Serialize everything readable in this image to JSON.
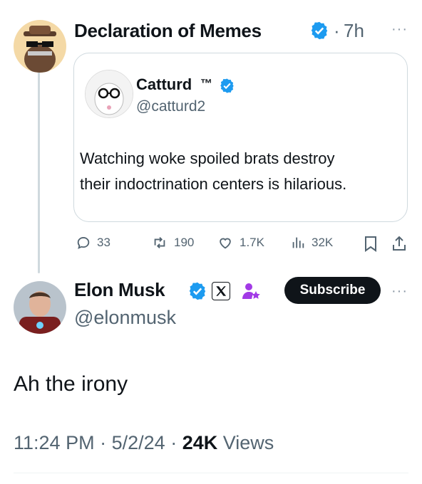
{
  "parent_tweet": {
    "author": "Declaration of Memes",
    "time_separator": "·",
    "time": "7h",
    "more": "···",
    "quoted": {
      "author": "Catturd",
      "tm": "™",
      "handle": "@catturd2",
      "text_line1": "Watching woke spoiled brats destroy",
      "text_line2": "their indoctrination centers is hilarious."
    },
    "actions": {
      "replies": "33",
      "reposts": "190",
      "likes": "1.7K",
      "views": "32K"
    }
  },
  "main_tweet": {
    "author": "Elon Musk",
    "handle": "@elonmusk",
    "subscribe_label": "Subscribe",
    "more": "···",
    "text": "Ah the irony",
    "time": "11:24 PM",
    "sep1": "·",
    "date": "5/2/24",
    "sep2": "·",
    "views_count": "24K",
    "views_label": "Views"
  },
  "colors": {
    "verified": "#1d9bf0",
    "text": "#0f1419",
    "muted": "#536471",
    "border": "#cfd9de",
    "affiliate_purple": "#a23ae6"
  }
}
